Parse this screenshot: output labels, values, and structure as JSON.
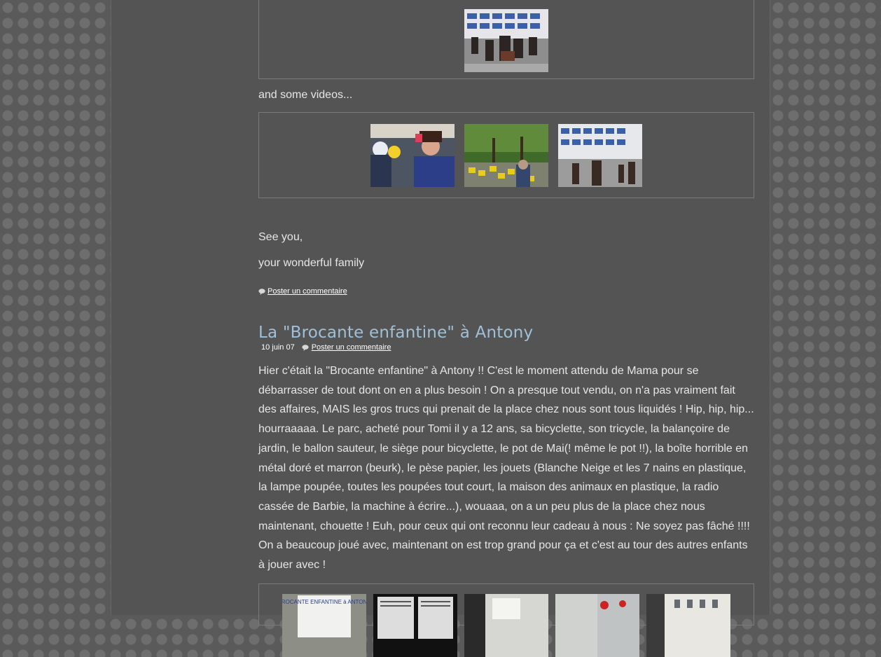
{
  "top_gallery": {
    "thumbs": [
      "photo-1"
    ]
  },
  "videos_intro": "and some videos...",
  "video_gallery": {
    "thumbs": [
      "video-1",
      "video-2",
      "video-3"
    ]
  },
  "closing": {
    "line1": "See you,",
    "line2": "your wonderful family"
  },
  "post1": {
    "comment_link": "Poster un commentaire"
  },
  "post2": {
    "title": "La \"Brocante enfantine\" à Antony",
    "date": "10 juin 07",
    "comment_link": "Poster un commentaire",
    "body": "Hier c'était la \"Brocante enfantine\" à Antony !! C'est le moment attendu de Mama pour se débarrasser de tout dont on en a plus besoin ! On a presque tout vendu, on n'a pas vraiment fait des affaires, MAIS les gros trucs qui prenait de la place chez nous sont tous liquidés ! Hip, hip, hip... hourraaaaa. Le parc, acheté pour Tomi il y a 12 ans, sa bicyclette, son tricycle, la balançoire de jardin, le ballon sauteur, le siège pour bicyclette, le pot de Mai(! même le pot !!), la boîte horrible en métal doré et marron (beurk), le pèse papier, les jouets (Blanche Neige et les 7 nains en plastique, la lampe poupée, toutes les poupées tout court, la maison des animaux en plastique, la radio cassée de Barbie, la machine à écrire...), wouaaa, on a un peu plus de la place chez nous maintenant, chouette ! Euh, pour ceux qui ont reconnu leur cadeau à nous : Ne soyez pas fâché !!!! On a beaucoup joué avec, maintenant on est trop grand pour ça et c'est au tour des autres enfants à jouer avec !",
    "gallery_sign_text": "BROCANTE ENFANTINE à ANTONY"
  }
}
